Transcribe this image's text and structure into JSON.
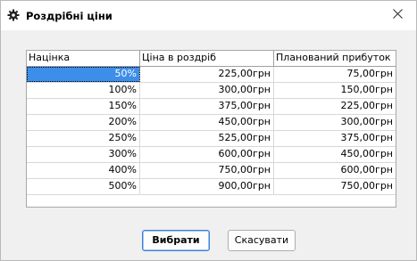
{
  "window": {
    "title": "Роздрібні ціни",
    "icon": "gear-icon",
    "close_icon": "close-icon"
  },
  "table": {
    "headers": [
      "Націнка",
      "Ціна в роздріб",
      "Планований прибуток"
    ],
    "rows": [
      [
        "50%",
        "225,00грн",
        "75,00грн"
      ],
      [
        "100%",
        "300,00грн",
        "150,00грн"
      ],
      [
        "150%",
        "375,00грн",
        "225,00грн"
      ],
      [
        "200%",
        "450,00грн",
        "300,00грн"
      ],
      [
        "250%",
        "525,00грн",
        "375,00грн"
      ],
      [
        "300%",
        "600,00грн",
        "450,00грн"
      ],
      [
        "400%",
        "750,00грн",
        "600,00грн"
      ],
      [
        "500%",
        "900,00грн",
        "750,00грн"
      ]
    ],
    "selected_row": 0,
    "selection_color": "#3d8ee8"
  },
  "buttons": {
    "select_label": "Вибрати",
    "cancel_label": "Скасувати"
  }
}
